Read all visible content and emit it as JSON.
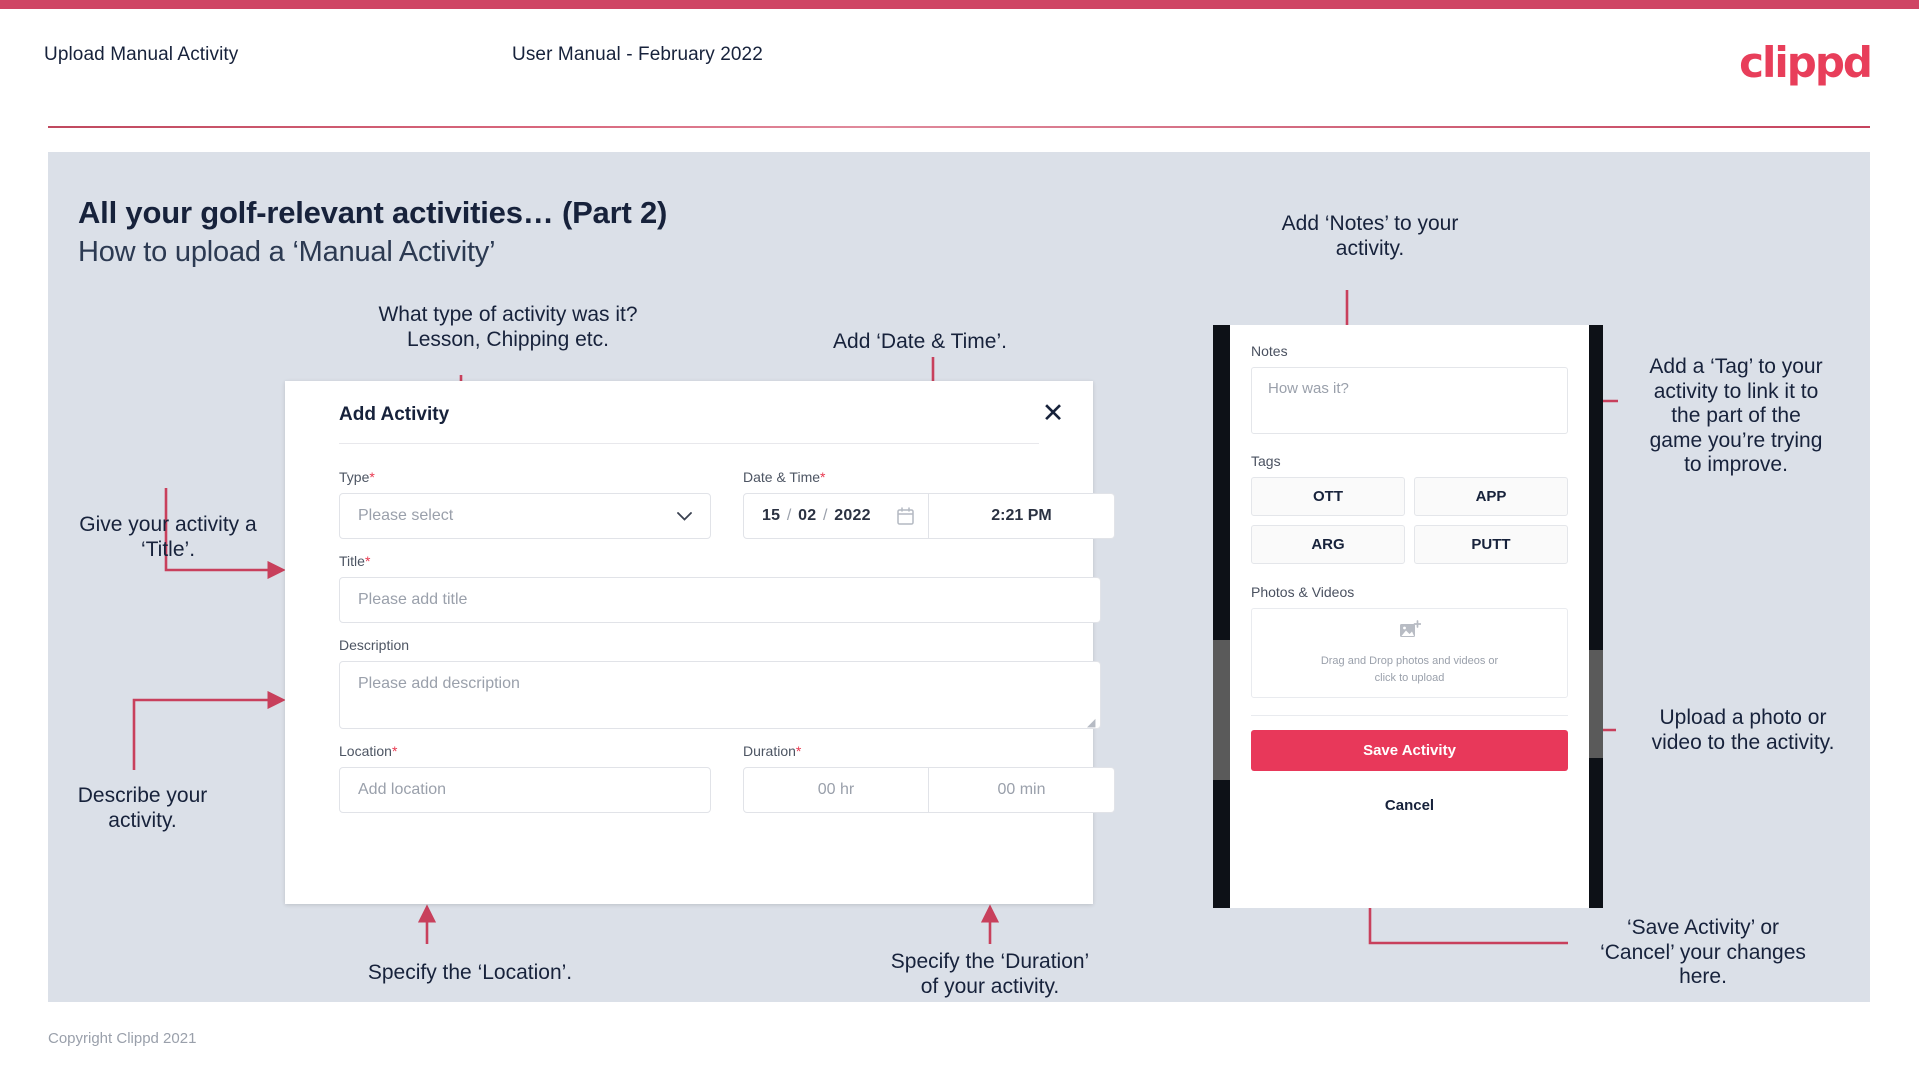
{
  "header": {
    "title": "Upload Manual Activity",
    "subtitle": "User Manual - February 2022",
    "logo": "clippd"
  },
  "slide": {
    "title": "All your golf-relevant activities… (Part 2)",
    "subtitle": "How to upload a ‘Manual Activity’"
  },
  "annotations": {
    "type": "What type of activity was it?\nLesson, Chipping etc.",
    "date_time": "Add ‘Date & Time’.",
    "notes": "Add ‘Notes’ to your\nactivity.",
    "tag": "Add a ‘Tag’ to your\nactivity to link it to\nthe part of the\ngame you’re trying\nto improve.",
    "title_field": "Give your activity a\n‘Title’.",
    "description": "Describe your\nactivity.",
    "location": "Specify the ‘Location’.",
    "duration": "Specify the ‘Duration’\nof your activity.",
    "upload": "Upload a photo or\nvideo to the activity.",
    "save_cancel": "‘Save Activity’ or\n‘Cancel’ your changes\nhere."
  },
  "modal": {
    "heading": "Add Activity",
    "close_label": "✕",
    "fields": {
      "type": {
        "label": "Type",
        "required": "*",
        "placeholder": "Please select"
      },
      "date_time": {
        "label": "Date & Time",
        "required": "*",
        "day": "15",
        "month": "02",
        "year": "2022",
        "time": "2:21 PM"
      },
      "title": {
        "label": "Title",
        "required": "*",
        "placeholder": "Please add title"
      },
      "description": {
        "label": "Description",
        "required": "",
        "placeholder": "Please add description"
      },
      "location": {
        "label": "Location",
        "required": "*",
        "placeholder": "Add location"
      },
      "duration": {
        "label": "Duration",
        "required": "*",
        "hours_placeholder": "00 hr",
        "minutes_placeholder": "00 min"
      }
    }
  },
  "phone": {
    "notes": {
      "label": "Notes",
      "placeholder": "How was it?"
    },
    "tags": {
      "label": "Tags",
      "items": [
        "OTT",
        "APP",
        "ARG",
        "PUTT"
      ]
    },
    "photos": {
      "label": "Photos & Videos",
      "dropzone_text": "Drag and Drop photos and videos or\nclick to upload"
    },
    "save_label": "Save Activity",
    "cancel_label": "Cancel"
  },
  "footer": {
    "copyright": "Copyright Clippd 2021"
  },
  "colors": {
    "accent": "#e8385a",
    "bar": "#cf4564",
    "slide_bg": "#dbe0e8",
    "ink": "#17223b",
    "wire": "#c8405c"
  }
}
